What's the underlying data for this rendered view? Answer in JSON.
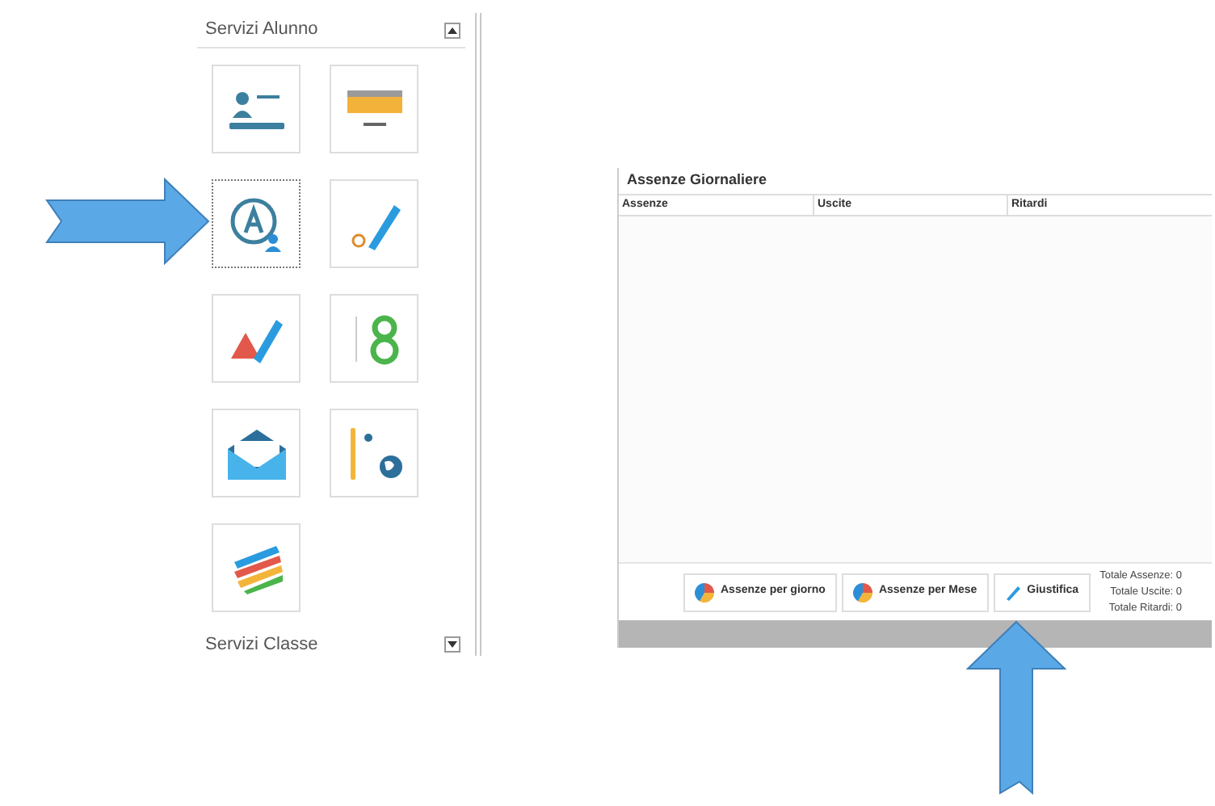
{
  "services_panel": {
    "title": "Servizi Alunno",
    "tiles": [
      {
        "kind": "profile",
        "selected": false
      },
      {
        "kind": "folder",
        "selected": false
      },
      {
        "kind": "absences",
        "selected": true
      },
      {
        "kind": "grade",
        "selected": false
      },
      {
        "kind": "warning",
        "selected": false
      },
      {
        "kind": "number",
        "selected": false
      },
      {
        "kind": "mail",
        "selected": false
      },
      {
        "kind": "globe",
        "selected": false
      },
      {
        "kind": "colors",
        "selected": false
      }
    ],
    "next_section": "Servizi Classe"
  },
  "absences_panel": {
    "title": "Assenze Giornaliere",
    "columns": [
      "Assenze",
      "Uscite",
      "Ritardi"
    ],
    "buttons": [
      {
        "kind": "chart",
        "label": "Assenze per giorno"
      },
      {
        "kind": "chart",
        "label": "Assenze per Mese"
      },
      {
        "kind": "pencil",
        "label": "Giustifica"
      }
    ],
    "totals": [
      "Totale Assenze: 0",
      "Totale Uscite: 0",
      "Totale Ritardi: 0"
    ]
  }
}
